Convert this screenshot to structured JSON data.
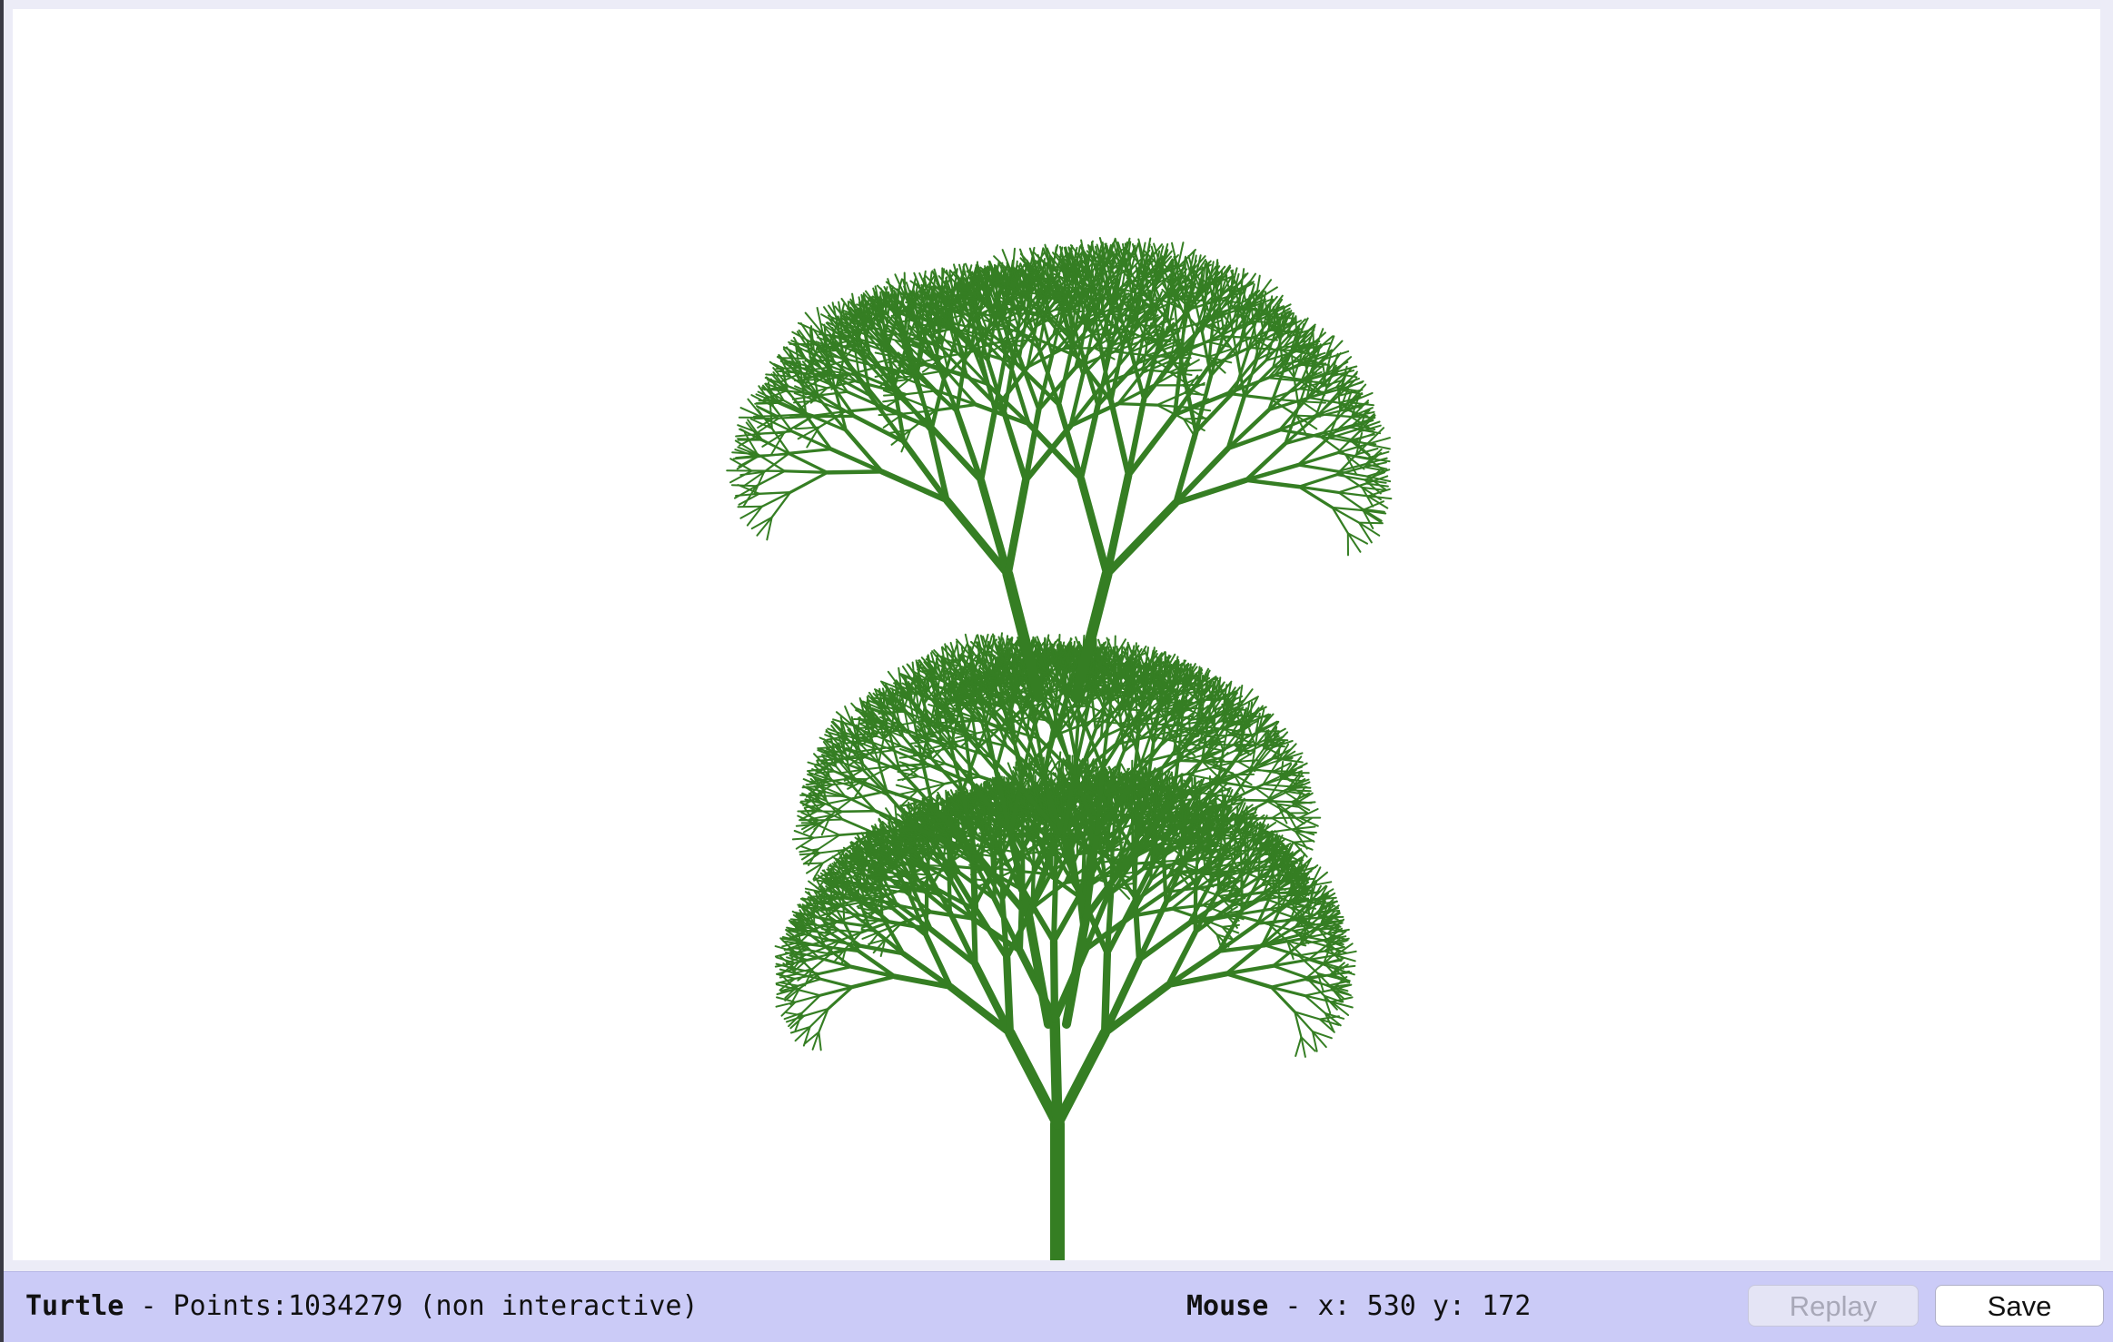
{
  "status": {
    "app_label": "Turtle",
    "points_text": "- Points:1034279 (non interactive)",
    "mouse_label": "Mouse",
    "mouse_text": "- x: 530 y: 172"
  },
  "buttons": {
    "replay_label": "Replay",
    "save_label": "Save"
  },
  "colors": {
    "plant": "#357e23",
    "canvas_bg": "#ffffff",
    "status_bg": "#cbcbf7"
  }
}
